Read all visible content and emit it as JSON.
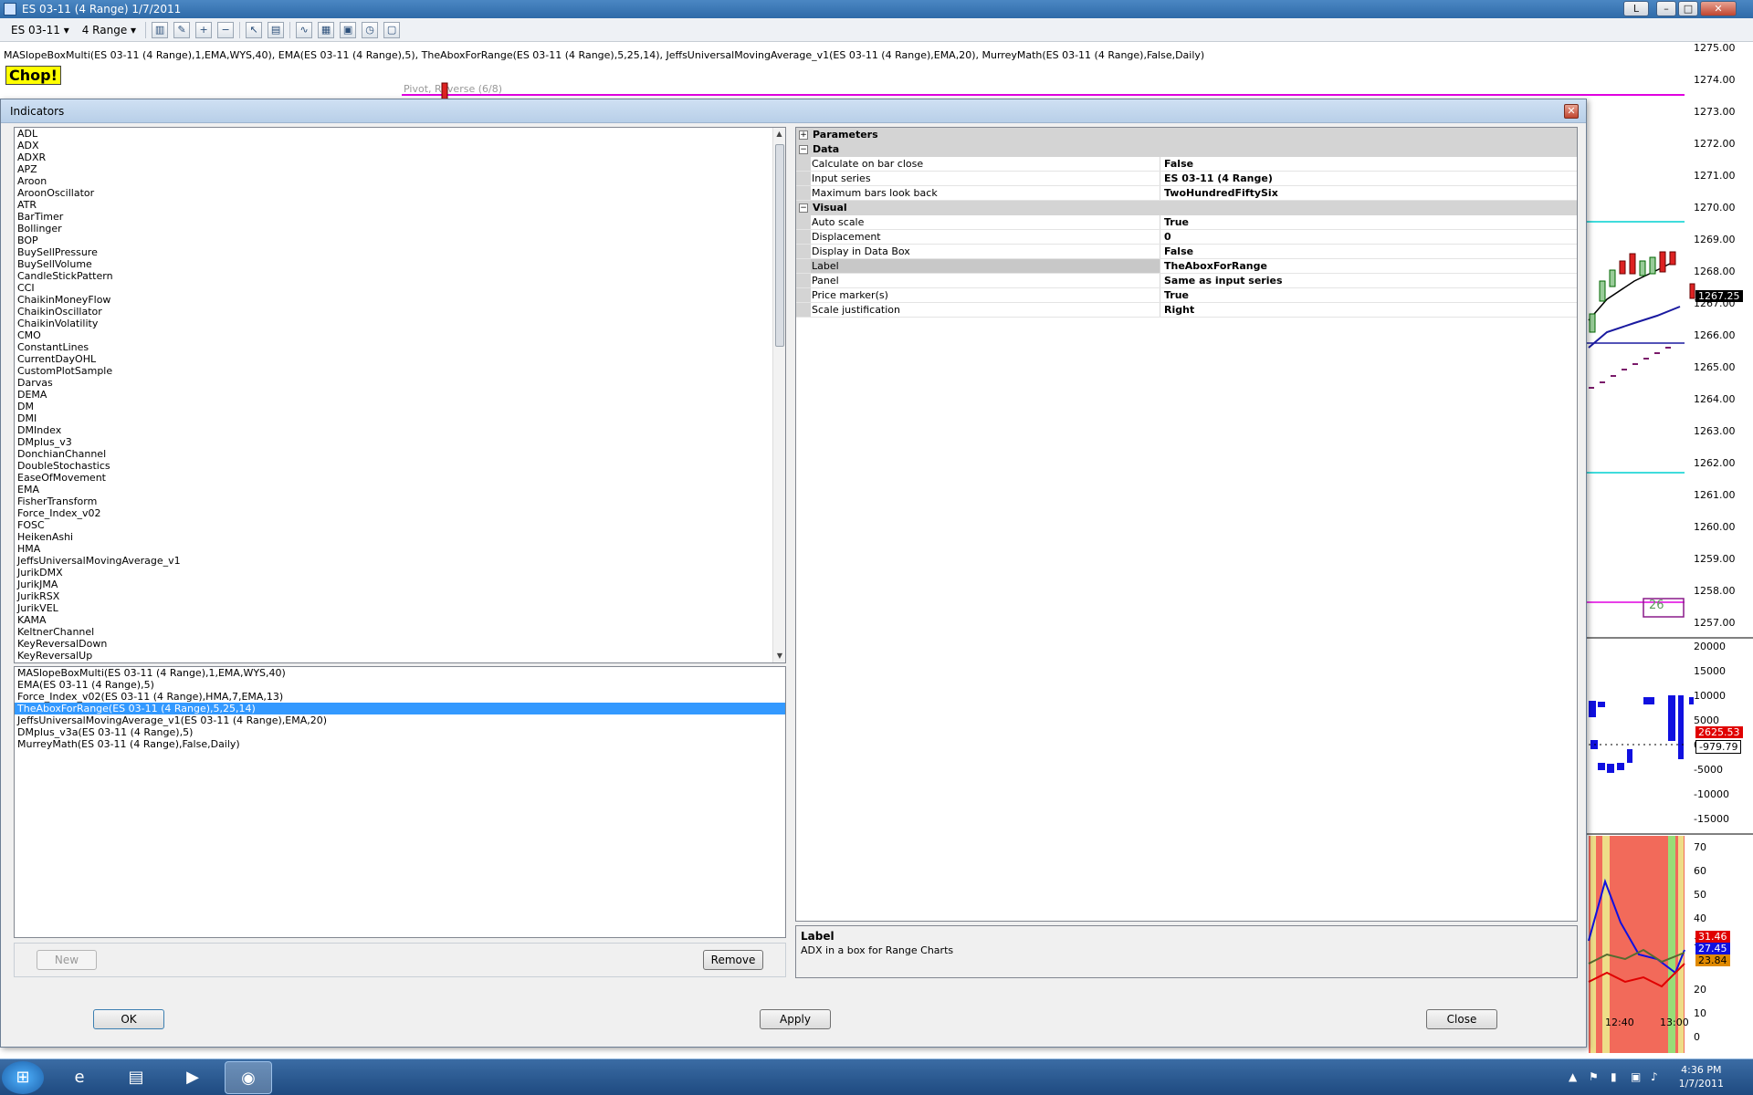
{
  "window": {
    "title": "ES 03-11 (4 Range)  1/7/2011",
    "controls": [
      "L",
      "–",
      "□",
      "✕"
    ]
  },
  "toolbar": {
    "instrument": "ES 03-11",
    "period": "4 Range"
  },
  "chart": {
    "indicator_line": "MASlopeBoxMulti(ES 03-11 (4 Range),1,EMA,WYS,40), EMA(ES 03-11 (4 Range),5), TheAboxForRange(ES 03-11 (4 Range),5,25,14), JeffsUniversalMovingAverage_v1(ES 03-11 (4 Range),EMA,20), MurreyMath(ES 03-11 (4 Range),False,Daily)",
    "chop_label": "Chop!",
    "pivot_label": "Pivot, Reverse (6/8)",
    "box_label": "26",
    "price_axis": [
      "1275.00",
      "1274.00",
      "1273.00",
      "1272.00",
      "1271.00",
      "1270.00",
      "1269.00",
      "1268.00",
      "1267.00",
      "1266.00",
      "1265.00",
      "1264.00",
      "1263.00",
      "1262.00",
      "1261.00",
      "1260.00",
      "1259.00",
      "1258.00",
      "1257.00"
    ],
    "last_price": "1267.25",
    "volume_axis": [
      "20000",
      "15000",
      "10000",
      "5000",
      "0",
      "-5000",
      "-10000",
      "-15000"
    ],
    "volume_tags": [
      "2625.53",
      "-979.79"
    ],
    "osc_axis": [
      "70",
      "60",
      "50",
      "40",
      "30",
      "20",
      "10",
      "0"
    ],
    "osc_tags": [
      "31.46",
      "27.45",
      "23.84"
    ],
    "time_axis": [
      "12:40",
      "13:00"
    ]
  },
  "dialog": {
    "title": "Indicators",
    "available_indicators": [
      "ADL",
      "ADX",
      "ADXR",
      "APZ",
      "Aroon",
      "AroonOscillator",
      "ATR",
      "BarTimer",
      "Bollinger",
      "BOP",
      "BuySellPressure",
      "BuySellVolume",
      "CandleStickPattern",
      "CCI",
      "ChaikinMoneyFlow",
      "ChaikinOscillator",
      "ChaikinVolatility",
      "CMO",
      "ConstantLines",
      "CurrentDayOHL",
      "CustomPlotSample",
      "Darvas",
      "DEMA",
      "DM",
      "DMI",
      "DMIndex",
      "DMplus_v3",
      "DonchianChannel",
      "DoubleStochastics",
      "EaseOfMovement",
      "EMA",
      "FisherTransform",
      "Force_Index_v02",
      "FOSC",
      "HeikenAshi",
      "HMA",
      "JeffsUniversalMovingAverage_v1",
      "JurikDMX",
      "JurikJMA",
      "JurikRSX",
      "JurikVEL",
      "KAMA",
      "KeltnerChannel",
      "KeyReversalDown",
      "KeyReversalUp"
    ],
    "applied_indicators": [
      "MASlopeBoxMulti(ES 03-11 (4 Range),1,EMA,WYS,40)",
      "EMA(ES 03-11 (4 Range),5)",
      "Force_Index_v02(ES 03-11 (4 Range),HMA,7,EMA,13)",
      "TheAboxForRange(ES 03-11 (4 Range),5,25,14)",
      "JeffsUniversalMovingAverage_v1(ES 03-11 (4 Range),EMA,20)",
      "DMplus_v3a(ES 03-11 (4 Range),5)",
      "MurreyMath(ES 03-11 (4 Range),False,Daily)"
    ],
    "selected_applied_index": 3,
    "new_label": "New",
    "remove_label": "Remove",
    "ok_label": "OK",
    "apply_label": "Apply",
    "close_label": "Close",
    "params": {
      "parameters_category": "Parameters",
      "data_category": "Data",
      "data_rows": [
        {
          "name": "Calculate on bar close",
          "value": "False"
        },
        {
          "name": "Input series",
          "value": "ES 03-11 (4 Range)"
        },
        {
          "name": "Maximum bars look back",
          "value": "TwoHundredFiftySix"
        }
      ],
      "visual_category": "Visual",
      "visual_rows": [
        {
          "name": "Auto scale",
          "value": "True"
        },
        {
          "name": "Displacement",
          "value": "0"
        },
        {
          "name": "Display in Data Box",
          "value": "False"
        },
        {
          "name": "Label",
          "value": "TheAboxForRange"
        },
        {
          "name": "Panel",
          "value": "Same as input series"
        },
        {
          "name": "Price marker(s)",
          "value": "True"
        },
        {
          "name": "Scale justification",
          "value": "Right"
        }
      ],
      "help_title": "Label",
      "help_text": "ADX in a box for Range Charts"
    }
  },
  "taskbar": {
    "time": "4:36 PM",
    "date": "1/7/2011"
  }
}
